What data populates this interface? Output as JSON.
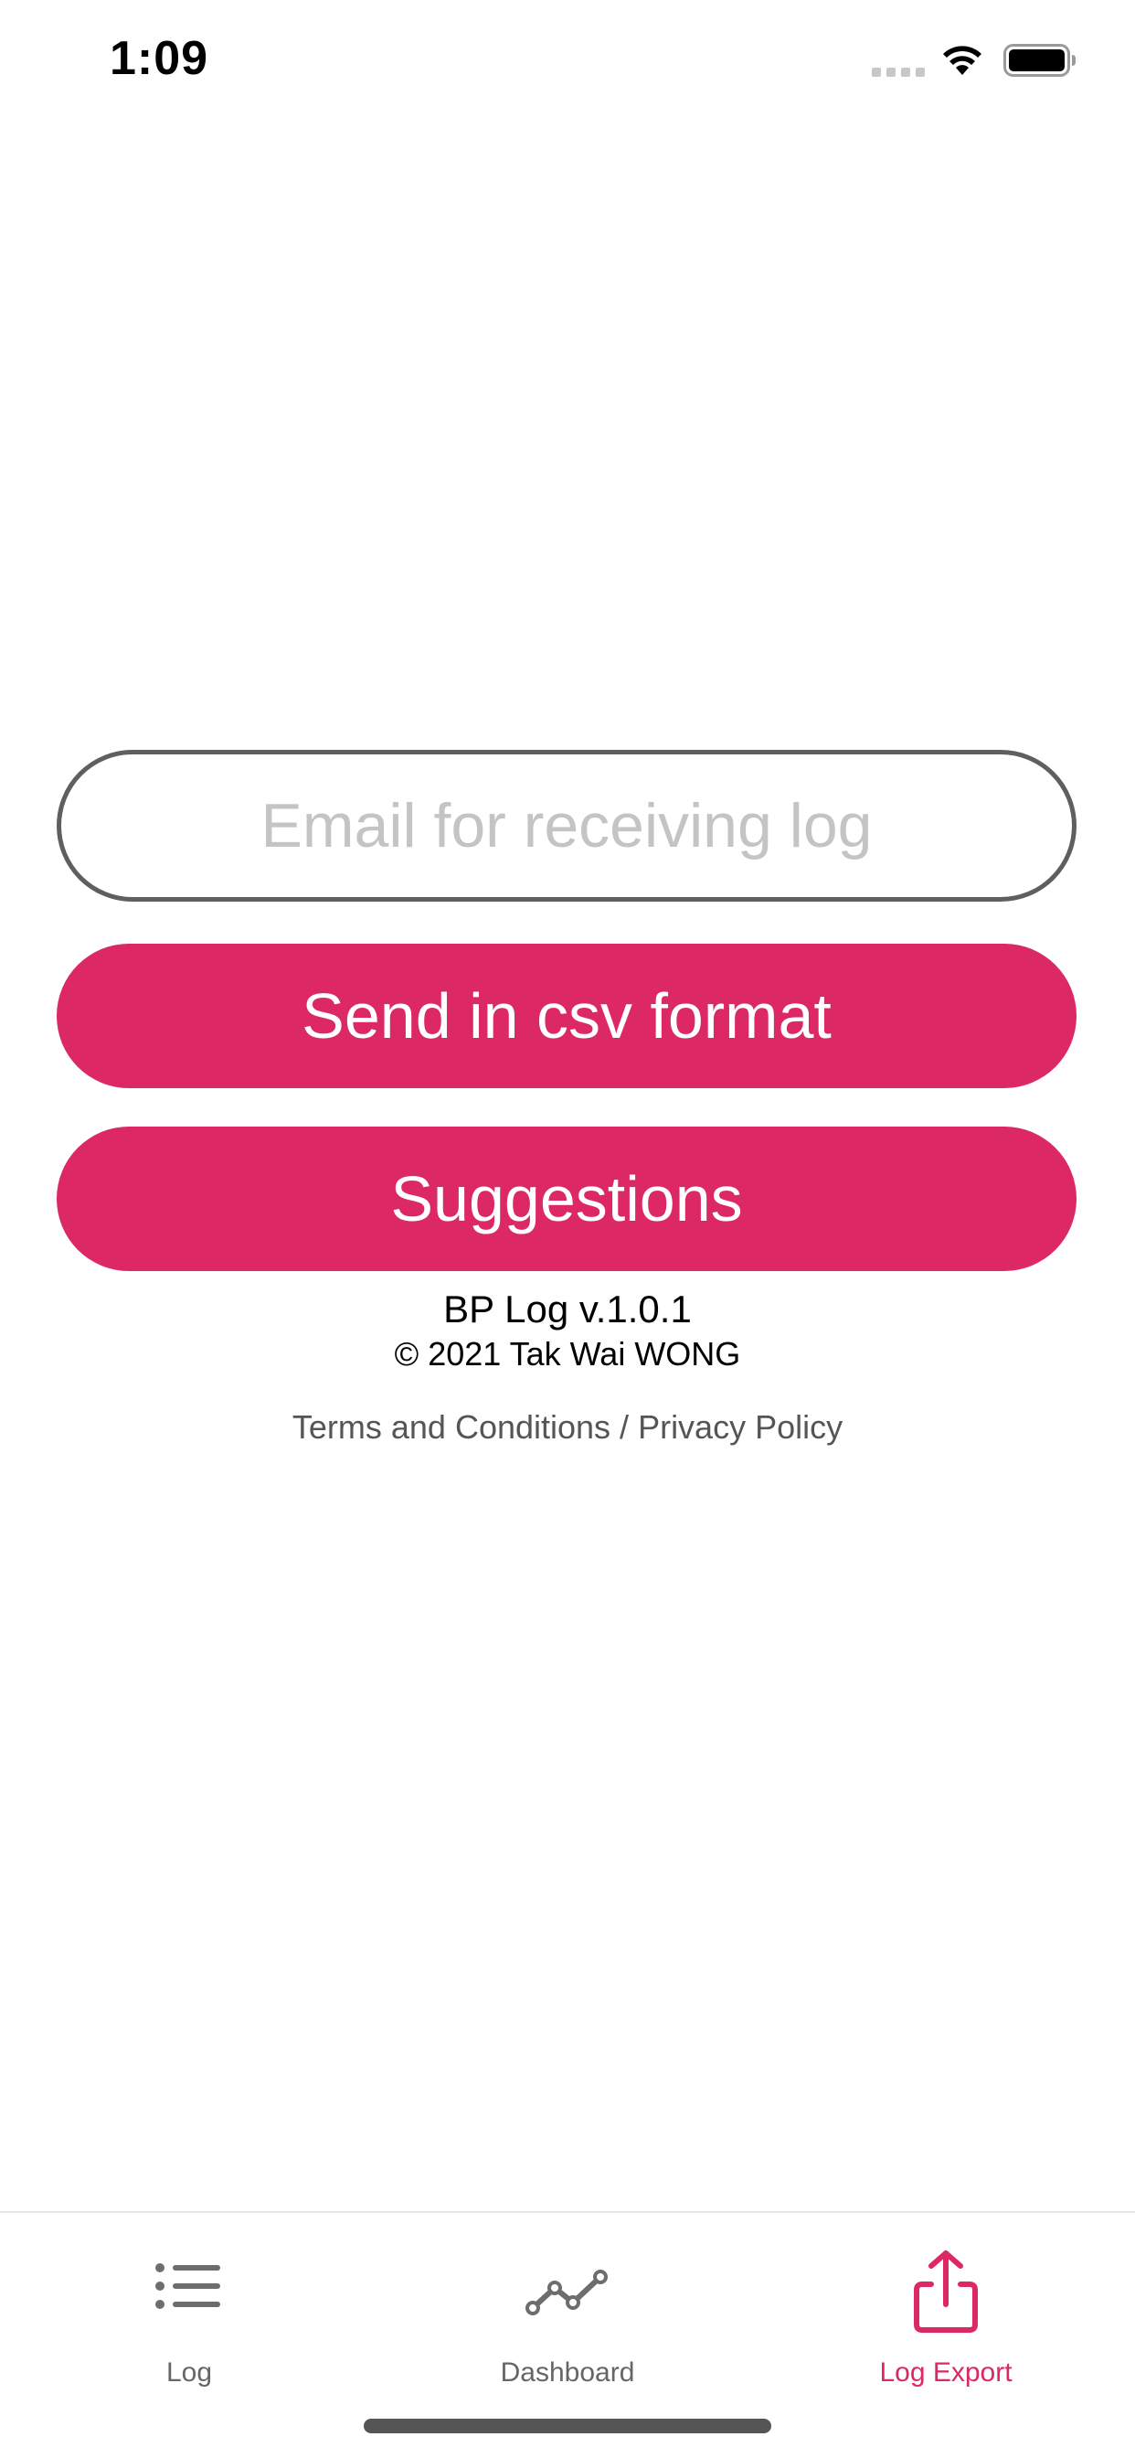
{
  "status_bar": {
    "time": "1:09",
    "icons": [
      "signal-icon",
      "wifi-icon",
      "battery-icon"
    ]
  },
  "form": {
    "email_placeholder": "Email for receiving log",
    "email_value": "",
    "send_label": "Send in csv format",
    "suggestions_label": "Suggestions"
  },
  "about": {
    "version": "BP Log v.1.0.1",
    "copyright": "© 2021 Tak Wai WONG"
  },
  "legal": {
    "terms": "Terms and Conditions",
    "separator": " / ",
    "privacy": "Privacy Policy"
  },
  "tabs": [
    {
      "label": "Log",
      "icon": "list-icon",
      "active": false
    },
    {
      "label": "Dashboard",
      "icon": "line-chart-icon",
      "active": false
    },
    {
      "label": "Log Export",
      "icon": "share-icon",
      "active": true
    }
  ],
  "colors": {
    "accent": "#dc2864",
    "inactive_tab": "#666666",
    "input_border": "#5f5f5f",
    "placeholder": "#c4c4c6"
  }
}
